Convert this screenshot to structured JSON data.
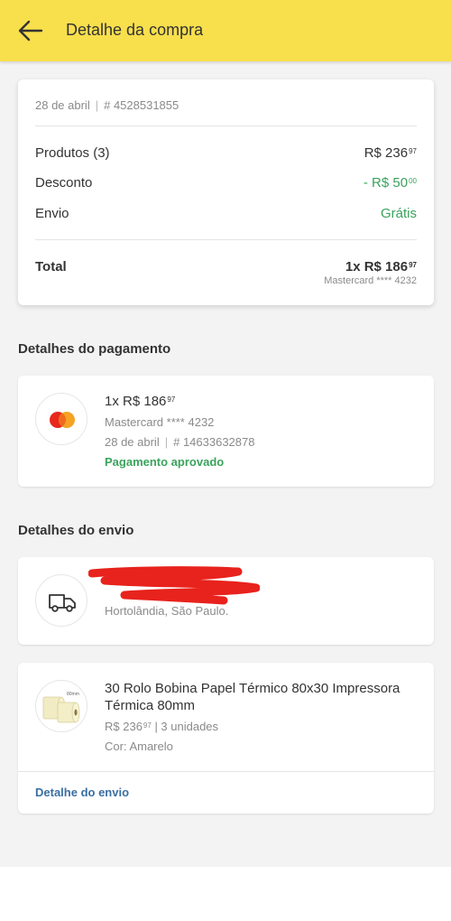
{
  "header": {
    "title": "Detalhe da compra"
  },
  "summary": {
    "date": "28 de abril",
    "separator": "|",
    "order_id": "# 4528531855",
    "products_label": "Produtos (3)",
    "products_value": "R$ 236",
    "products_cents": "97",
    "discount_label": "Desconto",
    "discount_value": "- R$ 50",
    "discount_cents": "00",
    "shipping_label": "Envio",
    "shipping_value": "Grátis",
    "total_label": "Total",
    "total_value": "1x R$ 186",
    "total_cents": "97",
    "total_card": "Mastercard **** 4232"
  },
  "payment": {
    "section_title": "Detalhes do pagamento",
    "amount": "1x R$ 186",
    "amount_cents": "97",
    "card": "Mastercard **** 4232",
    "date": "28 de abril",
    "separator": "|",
    "transaction_id": "# 14633632878",
    "status": "Pagamento aprovado"
  },
  "shipping": {
    "section_title": "Detalhes do envio",
    "address_line1": "",
    "address_line2": "Hortolândia, São Paulo."
  },
  "product": {
    "name": "30 Rolo Bobina Papel Térmico 80x30 Impressora Térmica 80mm",
    "price": "R$ 236",
    "price_cents": "97",
    "quantity": " | 3 unidades",
    "color": "Cor: Amarelo",
    "thumb_label": "80mm",
    "link": "Detalhe do envio"
  },
  "colors": {
    "header_bg": "#f8df4c",
    "green": "#3aa35c",
    "link_blue": "#3a6fa3",
    "redaction": "#e8221c"
  },
  "icons": {
    "back": "arrow-left-icon",
    "card": "mastercard-icon",
    "truck": "truck-icon"
  }
}
